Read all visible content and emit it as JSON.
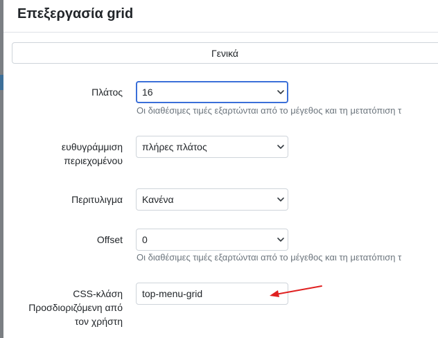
{
  "dialog": {
    "title": "Επεξεργασία grid"
  },
  "tabs": [
    {
      "label": "Γενικά"
    }
  ],
  "fields": {
    "width": {
      "label": "Πλάτος",
      "value": "16",
      "help": "Οι διαθέσιμες τιμές εξαρτώνται από το μέγεθος και τη μετατόπιση τ"
    },
    "alignment": {
      "label_line1": "ευθυγράμμιση",
      "label_line2": "περιεχομένου",
      "value": "πλήρες πλάτος"
    },
    "wrapping": {
      "label": "Περιτυλιγμα",
      "value": "Κανένα"
    },
    "offset": {
      "label": "Offset",
      "value": "0",
      "help": "Οι διαθέσιμες τιμές εξαρτώνται από το μέγεθος και τη μετατόπιση τ"
    },
    "css_class": {
      "label_line1": "CSS-κλάση",
      "label_line2": "Προσδιοριζόμενη από",
      "label_line3": "τον χρήστη",
      "value": "top-menu-grid"
    }
  },
  "colors": {
    "accent": "#3a6fd8",
    "annotation_arrow": "#e02020",
    "help_text": "#6c757d",
    "border": "#ced4da"
  },
  "icons": {
    "select_chevron": "chevron-down-icon",
    "annotation": "red-arrow-icon"
  }
}
